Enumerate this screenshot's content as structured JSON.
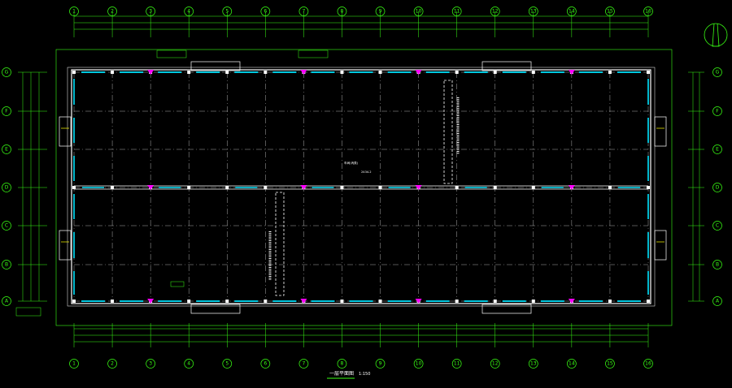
{
  "drawing": {
    "title": "一层平面图",
    "scale": "1:150",
    "room_label": "车间(丙类)",
    "room_area": "2434.2",
    "north_symbol": "north-arrow"
  },
  "column_grid": [
    "1",
    "2",
    "3",
    "4",
    "5",
    "6",
    "7",
    "8",
    "9",
    "10",
    "11",
    "12",
    "13",
    "14",
    "15",
    "16"
  ],
  "row_grid": [
    "G",
    "F",
    "E",
    "D",
    "C",
    "B",
    "A"
  ],
  "colors": {
    "background": "#000000",
    "axis": "#39ff14",
    "wall": "#ffffff",
    "window": "#00e5ff",
    "column": "#ff00ff",
    "gridline": "#ffffff",
    "text": "#ffffff",
    "accent_yellow": "#ffff00",
    "accent_red": "#ff3030"
  }
}
